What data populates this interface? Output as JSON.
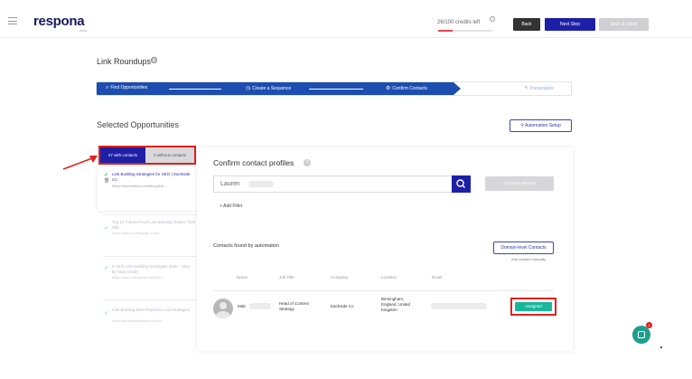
{
  "header": {
    "logo": "respona",
    "logo_sub": "beta",
    "credits_text": "26/100 credits left",
    "credits_used": 26,
    "credits_total": 100,
    "back_label": "Back",
    "next_label": "Next Step",
    "save_label": "Save & Close"
  },
  "page_title": "Link Roundups",
  "stepper": {
    "steps": [
      {
        "label": "Find Opportunities",
        "state": "done"
      },
      {
        "label": "Create a Sequence",
        "state": "done"
      },
      {
        "label": "Confirm Contacts",
        "state": "active"
      },
      {
        "label": "Personalize",
        "state": "pending"
      }
    ]
  },
  "selected_title": "Selected Opportunities",
  "automation_setup_label": "Automation Setup",
  "tabs": {
    "with_contacts": "27 with contacts",
    "without_contacts": "2 without contacts"
  },
  "opportunities": [
    {
      "title": "Link Building Strategies for SEO | Eachside Co",
      "url": "https://eachsideco.com/blog/link...",
      "active": true
    },
    {
      "title": "Top 10 Future-Proof Link Building Tactics That Will...",
      "url": "https://ankz.co/blog/top-10-lin...",
      "active": false
    },
    {
      "title": "5 SEO Link Building Strategies 2020 - Step by Step Guide",
      "url": "https://blog.muhamad.uk/link-b...",
      "active": false
    },
    {
      "title": "Link Building Best Practices And Strategies",
      "url": "https://monitorbacklinks.com/bl...",
      "active": false
    }
  ],
  "confirm": {
    "title": "Confirm contact profiles",
    "help": "?",
    "search_value": "Lauren",
    "contact_selected_label": "1 contact selected",
    "add_filter_label": "+ Add Filter",
    "found_label": "Contacts found by automation",
    "domain_contacts_label": "Domain-level Contacts",
    "add_manual_label": "Add contact manually",
    "columns": [
      "Name",
      "Job Title",
      "Company",
      "Location",
      "Email"
    ],
    "row": {
      "name": "Matt",
      "job_title": "Head of Content Strategy",
      "company": "Eachside Co",
      "location": "Birmingham, England, United Kingdom",
      "status": "Assigned"
    }
  },
  "chat_badge": "1",
  "colors": {
    "primary": "#1d20a6",
    "stepper": "#1c4db0",
    "assigned": "#17b89a",
    "highlight": "#e3211c",
    "check": "#3ec37d"
  }
}
